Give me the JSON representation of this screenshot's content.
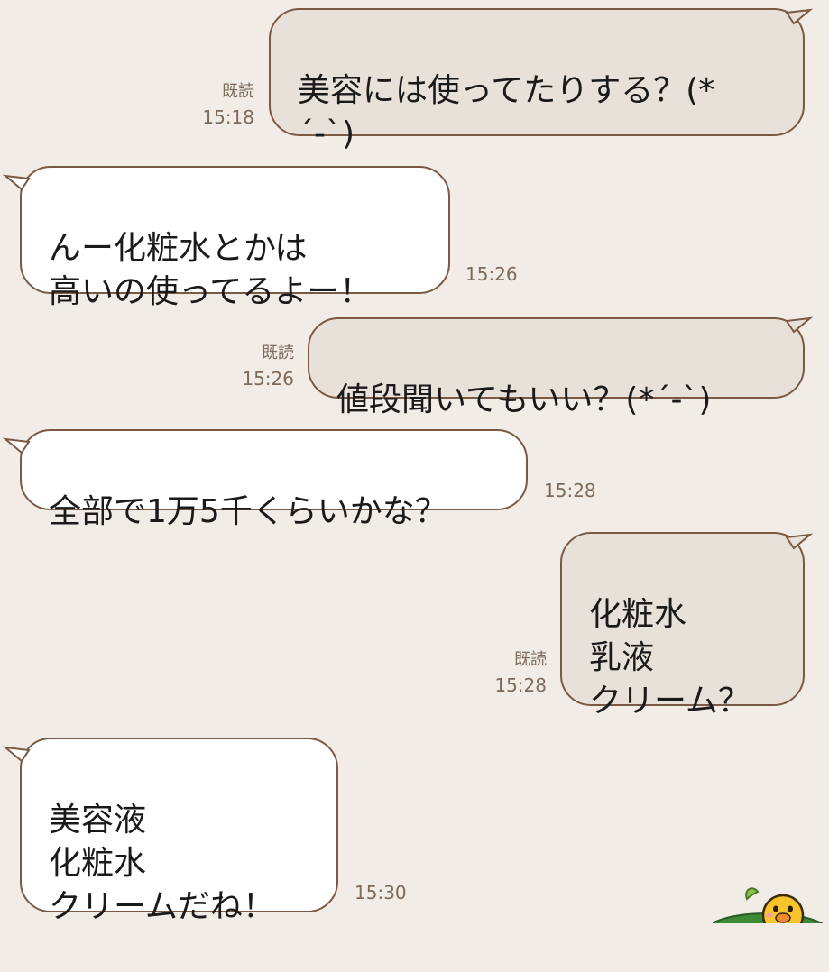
{
  "chat": {
    "messages": [
      {
        "side": "out",
        "text": "美容には使ってたりする？(*\n´-`)",
        "read": "既読",
        "time": "15:18"
      },
      {
        "side": "in",
        "text": "んー化粧水とかは\n高いの使ってるよー！",
        "time": "15:26"
      },
      {
        "side": "out",
        "text": "値段聞いてもいい？(*´-`)",
        "read": "既読",
        "time": "15:26"
      },
      {
        "side": "in",
        "text": "全部で1万5千くらいかな？",
        "time": "15:28"
      },
      {
        "side": "out",
        "text": "化粧水\n乳液\nクリーム？",
        "read": "既読",
        "time": "15:28"
      },
      {
        "side": "in",
        "text": "美容液\n化粧水\nクリームだね！",
        "time": "15:30"
      }
    ]
  },
  "colors": {
    "background": "#f1ece6",
    "bubble_out": "#e8e1d9",
    "bubble_in": "#ffffff",
    "border": "#7a5a44",
    "meta_text": "#7d6a5a"
  },
  "icons": {
    "sticker": "chick-sticker-icon"
  }
}
